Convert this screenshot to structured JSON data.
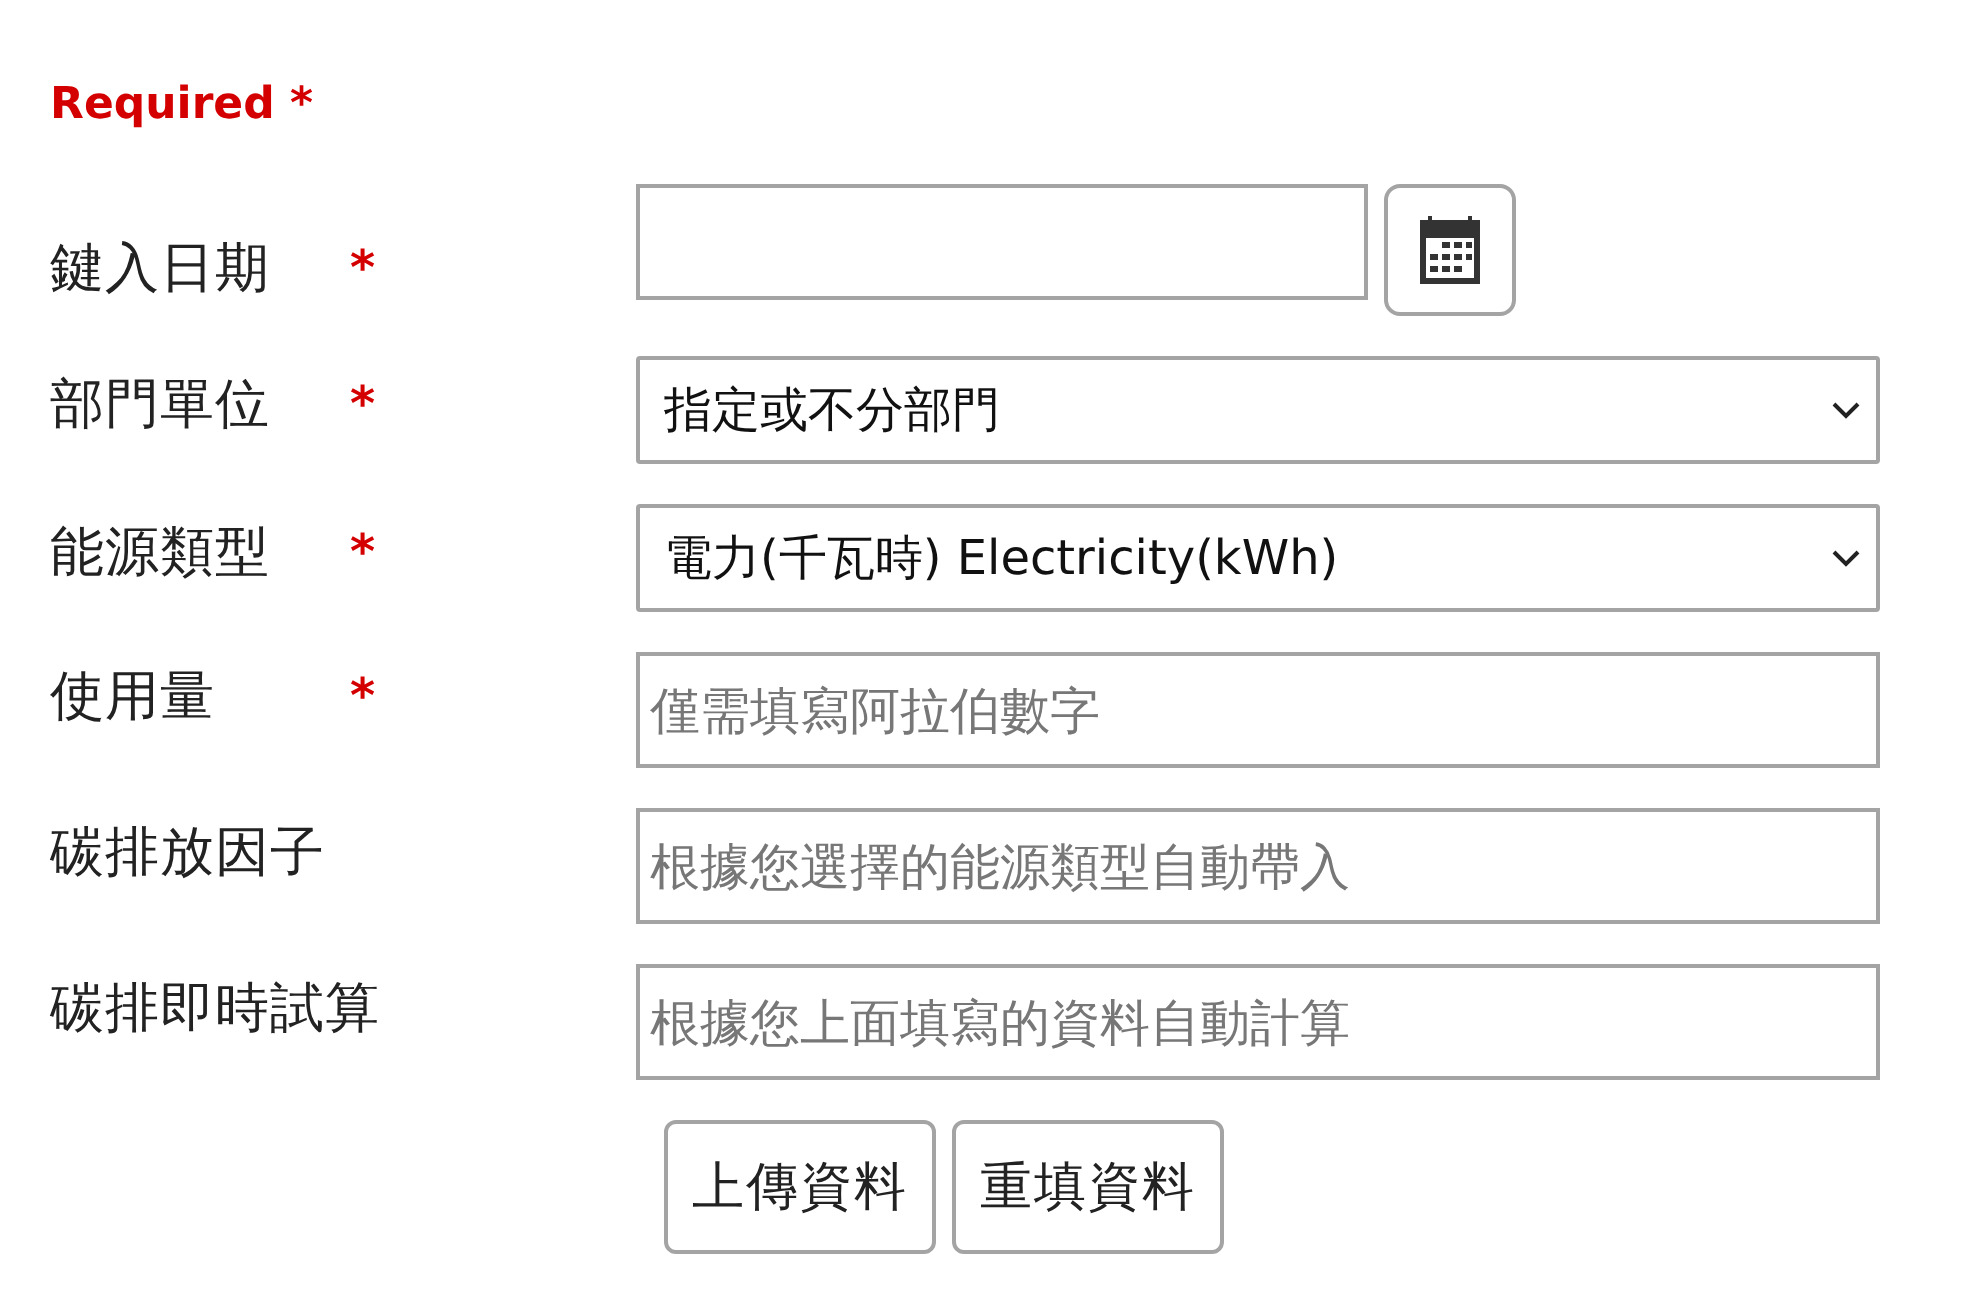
{
  "required_note": {
    "label": "Required",
    "mark": "*"
  },
  "fields": [
    {
      "kind": "date",
      "label": "鍵入日期",
      "required_mark": "*"
    },
    {
      "kind": "select",
      "label": "部門單位",
      "required_mark": "*",
      "value": "指定或不分部門"
    },
    {
      "kind": "select",
      "label": "能源類型",
      "required_mark": "*",
      "value": "電力(千瓦時) Electricity(kWh)"
    },
    {
      "kind": "text",
      "label": "使用量",
      "required_mark": "*",
      "placeholder": "僅需填寫阿拉伯數字"
    },
    {
      "kind": "text",
      "label": "碳排放因子",
      "placeholder": "根據您選擇的能源類型自動帶入"
    },
    {
      "kind": "text",
      "label": "碳排即時試算",
      "placeholder": "根據您上面填寫的資料自動計算"
    }
  ],
  "buttons": [
    "上傳資料",
    "重填資料"
  ]
}
